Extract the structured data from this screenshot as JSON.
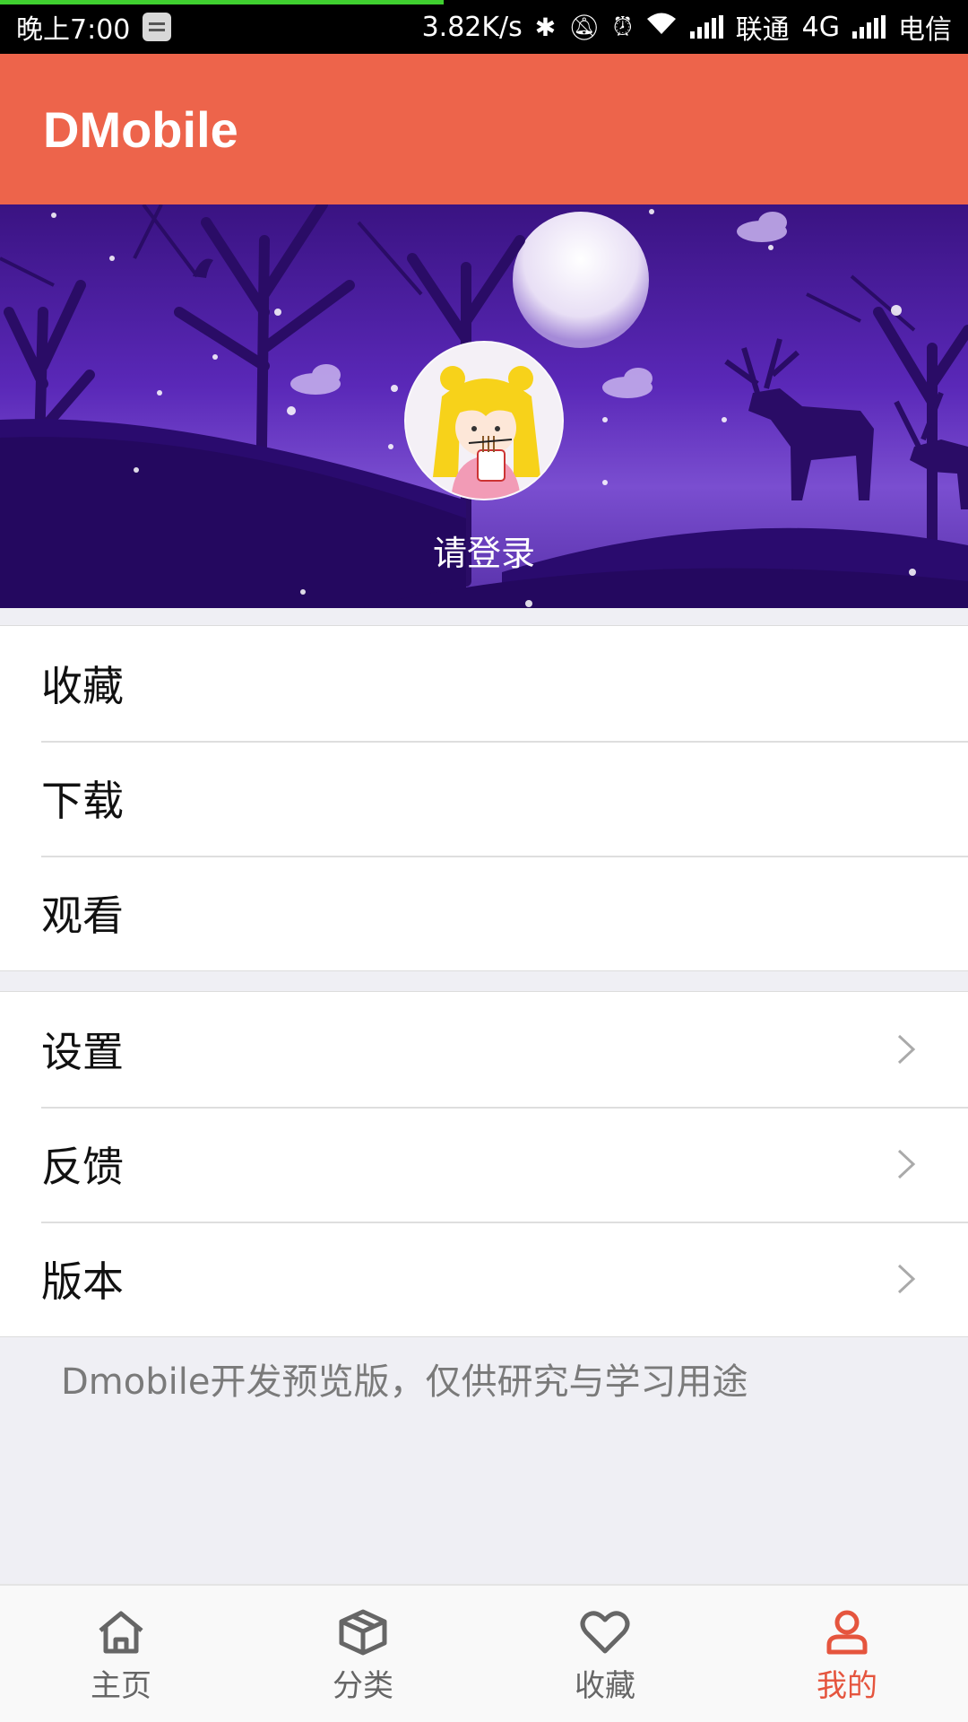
{
  "status_bar": {
    "time": "晚上7:00",
    "net_speed": "3.82K/s",
    "carrier1": "联通",
    "network": "4G",
    "carrier2": "电信"
  },
  "toolbar": {
    "title": "DMobile"
  },
  "profile": {
    "login_label": "请登录"
  },
  "menu_group_1": {
    "items": [
      {
        "label": "收藏"
      },
      {
        "label": "下载"
      },
      {
        "label": "观看"
      }
    ]
  },
  "menu_group_2": {
    "items": [
      {
        "label": "设置",
        "icon": "chevron-right-icon"
      },
      {
        "label": "反馈",
        "icon": "chevron-right-icon"
      },
      {
        "label": "版本",
        "icon": "chevron-right-icon"
      }
    ]
  },
  "footer_note": "Dmobile开发预览版，仅供研究与学习用途",
  "bottom_nav": {
    "items": [
      {
        "label": "主页",
        "icon": "home-icon",
        "active": false
      },
      {
        "label": "分类",
        "icon": "box-icon",
        "active": false
      },
      {
        "label": "收藏",
        "icon": "heart-icon",
        "active": false
      },
      {
        "label": "我的",
        "icon": "user-icon",
        "active": true
      }
    ]
  },
  "colors": {
    "accent": "#ed644b",
    "active_tab": "#e5553e",
    "banner_purple": "#5a28b8",
    "background": "#efeff4"
  }
}
